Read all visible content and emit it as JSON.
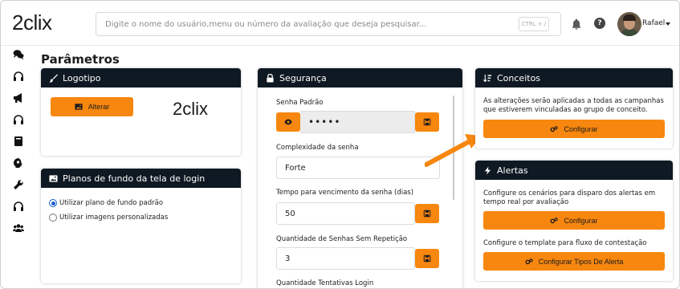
{
  "app": {
    "logo_text": "2clix"
  },
  "header": {
    "search_placeholder": "Digite o nome do usuário,menu ou número da avaliação que deseja pesquisar...",
    "shortcut_hint": "CTRL + /",
    "help_label": "?",
    "username": "Rafael"
  },
  "sidebar": {
    "icons": [
      "chat-icon",
      "headset-icon",
      "megaphone-icon",
      "headset-icon",
      "book-icon",
      "brain-icon",
      "wrench-icon",
      "headset-icon",
      "users-icon"
    ]
  },
  "page": {
    "title": "Parâmetros"
  },
  "logotipo": {
    "title": "Logotipo",
    "alter_button": "Alterar",
    "logo_preview_text": "2clix"
  },
  "planos": {
    "title": "Planos de fundo da tela de login",
    "option_default": "Utilizar plano de fundo padrão",
    "option_custom": "Utilizar imagens personalizadas",
    "selected": "default"
  },
  "seguranca": {
    "title": "Segurança",
    "senha_label": "Senha Padrão",
    "senha_value": "•••••",
    "complexidade_label": "Complexidade da senha",
    "complexidade_value": "Forte",
    "tempo_label": "Tempo para vencimento da senha (dias)",
    "tempo_value": "50",
    "quantidade_label": "Quantidade de Senhas Sem Repetição",
    "quantidade_value": "3",
    "tentativas_label": "Quantidade Tentativas Login"
  },
  "conceitos": {
    "title": "Conceitos",
    "description": "As alterações serão aplicadas a todas as campanhas que estiverem vinculadas ao grupo de conceito.",
    "button": "Configurar"
  },
  "alertas": {
    "title": "Alertas",
    "description": "Configure os cenários para disparo dos alertas em tempo real por avaliação",
    "button": "Configurar",
    "template_text": "Configure o template para fluxo de contestação",
    "template_button": "Configurar Tipos De Alerta"
  },
  "colors": {
    "accent": "#f7870f",
    "header_dark": "#0f1923",
    "radio_blue": "#1a5fd1"
  }
}
